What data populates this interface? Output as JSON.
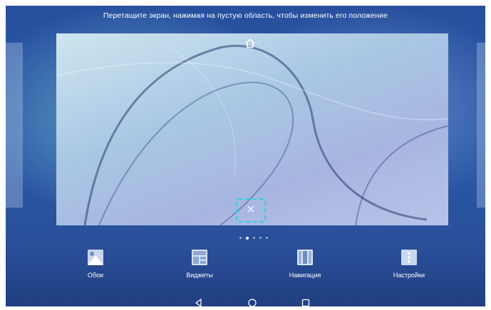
{
  "hint": "Перетащите экран, нажимая на пустую область, чтобы изменить его положение",
  "preview": {
    "home_icon": "home-icon",
    "delete_icon": "close-icon",
    "delete_glyph": "✕",
    "accent": "#2bd1e8"
  },
  "pager": {
    "count": 5,
    "active_index": 1
  },
  "menu": {
    "items": [
      {
        "label": "Обои",
        "icon": "wallpaper-icon"
      },
      {
        "label": "Виджеты",
        "icon": "widgets-icon"
      },
      {
        "label": "Навигация",
        "icon": "navigation-icon"
      },
      {
        "label": "Настройки",
        "icon": "settings-icon"
      }
    ]
  },
  "nav": {
    "back": "back-icon",
    "home": "home-nav-icon",
    "recents": "recents-icon"
  },
  "colors": {
    "background": "#2b5aa8",
    "text": "#ffffff"
  }
}
